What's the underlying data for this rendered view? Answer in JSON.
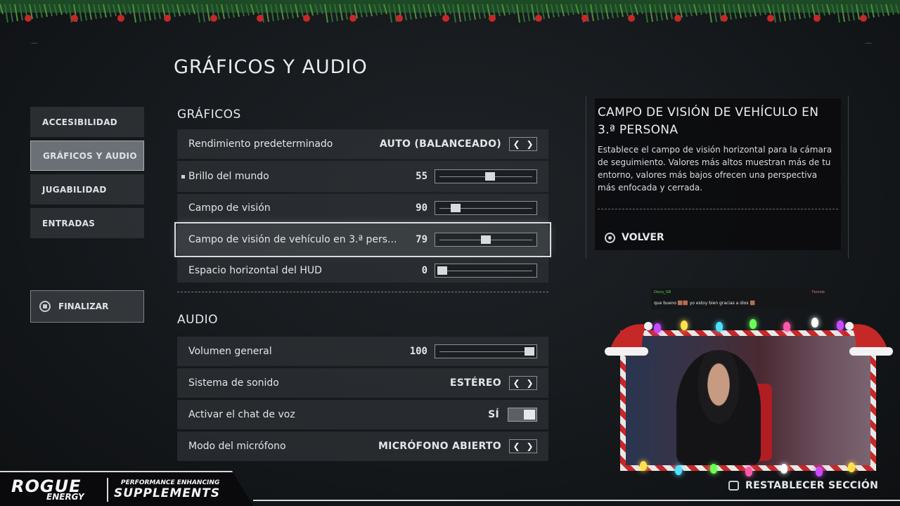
{
  "page": {
    "title": "GRÁFICOS Y AUDIO"
  },
  "sidebar": {
    "items": [
      {
        "label": "ACCESIBILIDAD",
        "active": false
      },
      {
        "label": "GRÁFICOS Y AUDIO",
        "active": true
      },
      {
        "label": "JUGABILIDAD",
        "active": false
      },
      {
        "label": "ENTRADAS",
        "active": false
      }
    ],
    "finalize_label": "FINALIZAR",
    "finalize_icon": "square-button-icon"
  },
  "graphics": {
    "section_title": "GRÁFICOS",
    "rows": [
      {
        "label": "Rendimiento predeterminado",
        "value": "AUTO (BALANCEADO)",
        "control": "arrows"
      },
      {
        "label": "Brillo del mundo",
        "value": "55",
        "control": "slider",
        "level": 0.55
      },
      {
        "label": "Campo de visión",
        "value": "90",
        "control": "slider",
        "level": 0.15
      },
      {
        "label": "Campo de visión de vehículo en 3.ª pers...",
        "value": "79",
        "control": "slider",
        "level": 0.5
      },
      {
        "label": "Espacio horizontal del HUD",
        "value": "0",
        "control": "slider",
        "level": 0.0
      }
    ]
  },
  "audio": {
    "section_title": "AUDIO",
    "rows": [
      {
        "label": "Volumen general",
        "value": "100",
        "control": "slider",
        "level": 1.0
      },
      {
        "label": "Sistema de sonido",
        "value": "ESTÉREO",
        "control": "arrows"
      },
      {
        "label": "Activar el chat de voz",
        "value": "SÍ",
        "control": "toggle"
      },
      {
        "label": "Modo del micrófono",
        "value": "MICRÓFONO ABIERTO",
        "control": "arrows"
      }
    ]
  },
  "info": {
    "title": "CAMPO DE VISIÓN DE VEHÍCULO EN 3.ª PERSONA",
    "description": "Establece el campo de visión horizontal para la cámara de seguimiento. Valores más altos muestran más de tu entorno, valores más bajos ofrecen una perspectiva más enfocada y cerrada.",
    "back_label": "VOLVER"
  },
  "chat": {
    "user": "Diony_GR",
    "badge": "Femole",
    "message": "que bueno 🟫🟫 yo estoy bien gracias a dios 🟫"
  },
  "footer": {
    "reset_label": "RESTABLECER SECCIÓN"
  },
  "sponsor": {
    "brand": "ROGUE",
    "brand_sub": "ENERGY",
    "tagline_top": "PERFORMANCE ENHANCING",
    "tagline_main": "SUPPLEMENTS"
  },
  "colors": {
    "accent": "#d9dcdf",
    "panel": "#2e3236",
    "background": "#15181b",
    "christmas_red": "#c62828"
  }
}
